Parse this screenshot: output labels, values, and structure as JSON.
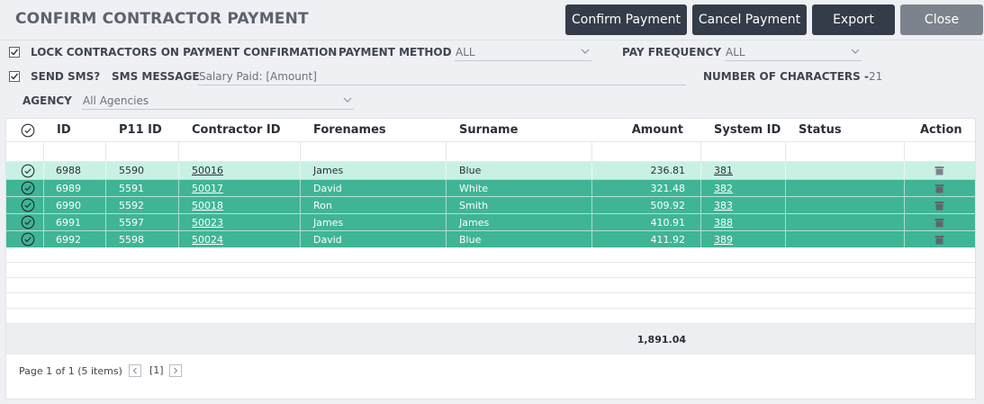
{
  "title": "CONFIRM CONTRACTOR PAYMENT",
  "buttons": {
    "confirm": "Confirm Payment",
    "cancel": "Cancel Payment",
    "export": "Export",
    "close": "Close"
  },
  "filters": {
    "lock_label": "LOCK CONTRACTORS ON PAYMENT CONFIRMATION",
    "lock_checked": true,
    "payment_method_label": "PAYMENT METHOD",
    "payment_method_value": "ALL",
    "pay_frequency_label": "PAY FREQUENCY",
    "pay_frequency_value": "ALL",
    "send_sms_label": "SEND SMS?",
    "send_sms_checked": true,
    "sms_message_label": "SMS MESSAGE",
    "sms_message_value": "Salary Paid: [Amount]",
    "num_chars_label": "NUMBER OF CHARACTERS -",
    "num_chars_value": "21",
    "agency_label": "AGENCY",
    "agency_value": "All Agencies"
  },
  "table": {
    "columns": [
      "ID",
      "P11 ID",
      "Contractor ID",
      "Forenames",
      "Surname",
      "Amount",
      "System ID",
      "Status",
      "Action"
    ],
    "rows": [
      {
        "id": "6988",
        "p11": "5590",
        "contractor": "50016",
        "forenames": "James",
        "surname": "Blue",
        "amount": "236.81",
        "system": "381",
        "status": ""
      },
      {
        "id": "6989",
        "p11": "5591",
        "contractor": "50017",
        "forenames": "David",
        "surname": "White",
        "amount": "321.48",
        "system": "382",
        "status": ""
      },
      {
        "id": "6990",
        "p11": "5592",
        "contractor": "50018",
        "forenames": "Ron",
        "surname": "Smith",
        "amount": "509.92",
        "system": "383",
        "status": ""
      },
      {
        "id": "6991",
        "p11": "5597",
        "contractor": "50023",
        "forenames": "James",
        "surname": "James",
        "amount": "410.91",
        "system": "388",
        "status": ""
      },
      {
        "id": "6992",
        "p11": "5598",
        "contractor": "50024",
        "forenames": "David",
        "surname": "Blue",
        "amount": "411.92",
        "system": "389",
        "status": ""
      }
    ],
    "total": "1,891.04"
  },
  "pagination": {
    "summary": "Page 1 of 1 (5 items)",
    "current": "[1]"
  },
  "colors": {
    "row_highlight": "#c8f1e4",
    "row_selected": "#3fb596",
    "button_dark": "#353c49",
    "button_disabled": "#7d838c"
  }
}
